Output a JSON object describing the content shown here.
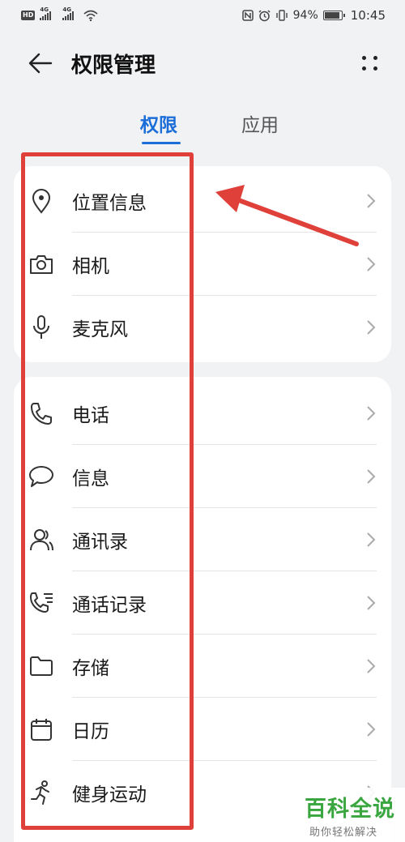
{
  "status_bar": {
    "hd": "HD",
    "sim1": "4G",
    "sim2": "4G",
    "battery_text": "94%",
    "battery_level": 0.94,
    "time": "10:45"
  },
  "header": {
    "title": "权限管理",
    "back_icon": "arrow-left-icon",
    "more_icon": "more-dots-icon"
  },
  "tabs": [
    {
      "label": "权限",
      "active": true
    },
    {
      "label": "应用",
      "active": false
    }
  ],
  "permission_groups": [
    {
      "items": [
        {
          "label": "位置信息",
          "icon": "location-pin-icon"
        },
        {
          "label": "相机",
          "icon": "camera-icon"
        },
        {
          "label": "麦克风",
          "icon": "microphone-icon"
        }
      ]
    },
    {
      "items": [
        {
          "label": "电话",
          "icon": "phone-icon"
        },
        {
          "label": "信息",
          "icon": "message-bubble-icon"
        },
        {
          "label": "通讯录",
          "icon": "contacts-icon"
        },
        {
          "label": "通话记录",
          "icon": "call-log-icon"
        },
        {
          "label": "存储",
          "icon": "folder-icon"
        },
        {
          "label": "日历",
          "icon": "calendar-icon"
        },
        {
          "label": "健身运动",
          "icon": "running-icon"
        }
      ]
    }
  ],
  "annotation": {
    "color": "#e0403a"
  },
  "watermark": {
    "main": "百科全说",
    "sub": "助你轻松解决"
  },
  "colors": {
    "accent": "#1b6ed8",
    "background": "#f1f2f4",
    "watermark_green": "#3aa63f"
  }
}
